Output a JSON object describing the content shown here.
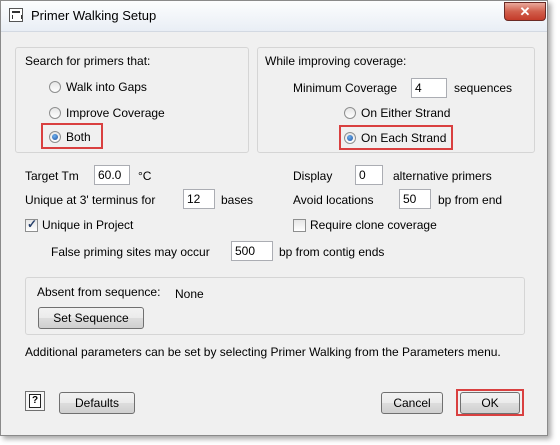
{
  "window": {
    "title": "Primer Walking Setup",
    "close_label": "✕"
  },
  "search_group": {
    "label": "Search for primers that:",
    "options": [
      {
        "label": "Walk into Gaps",
        "selected": false
      },
      {
        "label": "Improve Coverage",
        "selected": false
      },
      {
        "label": "Both",
        "selected": true
      }
    ]
  },
  "coverage_group": {
    "label": "While improving coverage:",
    "min_coverage_label": "Minimum Coverage",
    "min_coverage_value": "4",
    "min_coverage_unit": "sequences",
    "strand_options": [
      {
        "label": "On Either Strand",
        "selected": false
      },
      {
        "label": "On Each Strand",
        "selected": true
      }
    ]
  },
  "params": {
    "target_tm_label": "Target Tm",
    "target_tm_value": "60.0",
    "target_tm_unit": "°C",
    "unique3_label": "Unique at 3' terminus for",
    "unique3_value": "12",
    "unique3_unit": "bases",
    "unique_project_label": "Unique in Project",
    "unique_project_checked": true,
    "false_priming_label": "False priming sites may occur",
    "false_priming_value": "500",
    "false_priming_unit": "bp from contig ends",
    "display_label": "Display",
    "display_value": "0",
    "display_unit": "alternative primers",
    "avoid_label": "Avoid locations",
    "avoid_value": "50",
    "avoid_unit": "bp from end",
    "require_clone_label": "Require clone coverage",
    "require_clone_checked": false
  },
  "absent_group": {
    "label": "Absent from sequence:",
    "value": "None",
    "set_button": "Set Sequence"
  },
  "note": "Additional parameters can be set by selecting Primer Walking from the Parameters menu.",
  "footer": {
    "help_label": "?",
    "defaults_button": "Defaults",
    "cancel_button": "Cancel",
    "ok_button": "OK"
  },
  "colors": {
    "highlight": "#d94040",
    "accent": "#1f4f9e",
    "window_bg": "#f0f0f0"
  }
}
